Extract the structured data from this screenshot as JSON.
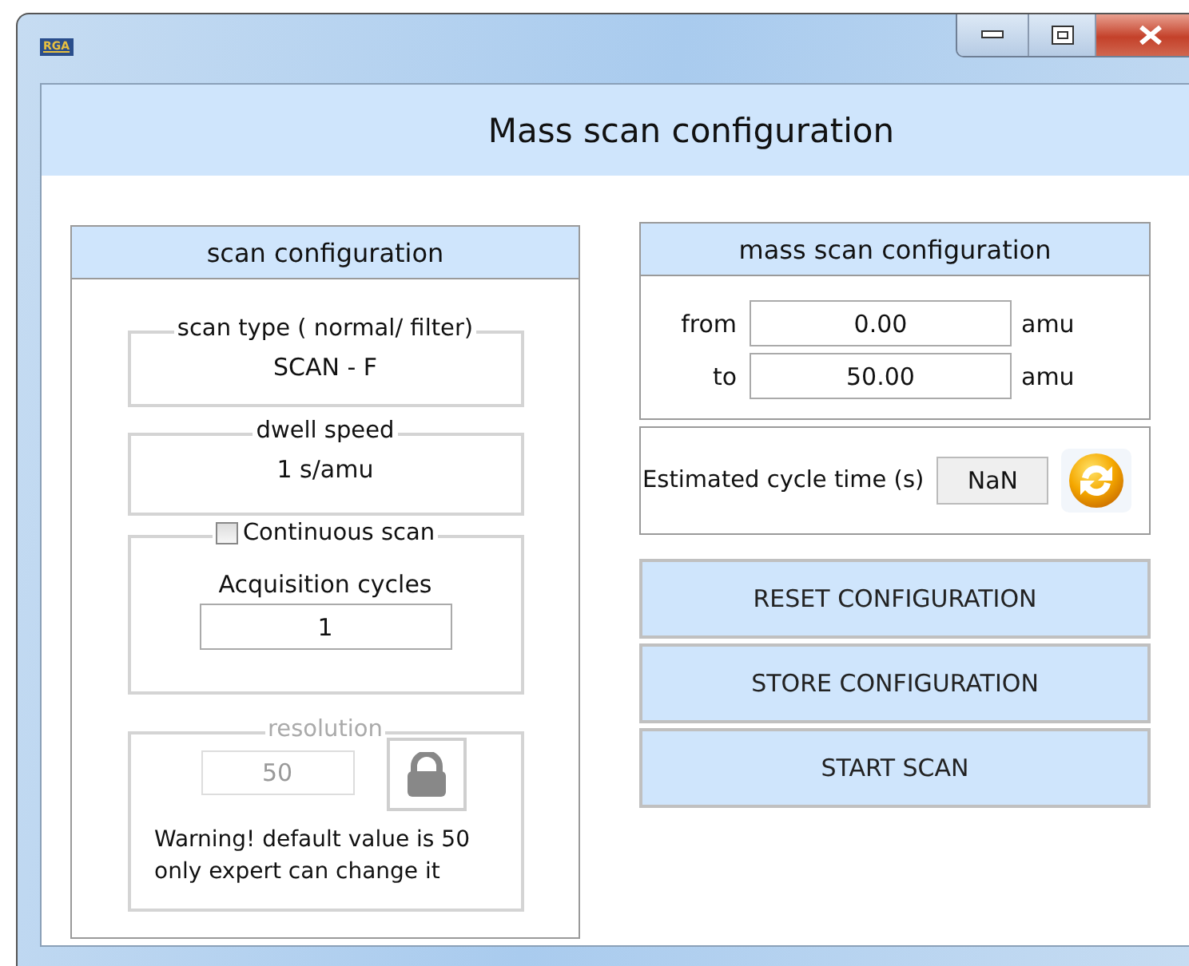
{
  "window": {
    "icon_text": "RGA",
    "title": "Mass scan configuration"
  },
  "scan_configuration": {
    "title": "scan configuration",
    "scan_type": {
      "label": "scan type ( normal/ filter)",
      "value": "SCAN - F"
    },
    "dwell_speed": {
      "label": "dwell speed",
      "value": "1 s/amu"
    },
    "continuous_scan": {
      "label": "Continuous scan",
      "checked": false
    },
    "acquisition_cycles": {
      "label": "Acquisition cycles",
      "value": "1"
    },
    "resolution": {
      "label": "resolution",
      "value": "50",
      "disabled": true,
      "locked": true
    },
    "warning": "Warning! default value is 50\nonly expert can change it"
  },
  "mass_scan_configuration": {
    "title": "mass scan configuration",
    "range": [
      {
        "label": "from",
        "value": "0.00",
        "unit": "amu"
      },
      {
        "label": "to",
        "value": "50.00",
        "unit": "amu"
      }
    ]
  },
  "cycle_time": {
    "label": "Estimated cycle time (s)",
    "value": "NaN"
  },
  "buttons": [
    "RESET CONFIGURATION",
    "STORE CONFIGURATION",
    "START SCAN"
  ]
}
